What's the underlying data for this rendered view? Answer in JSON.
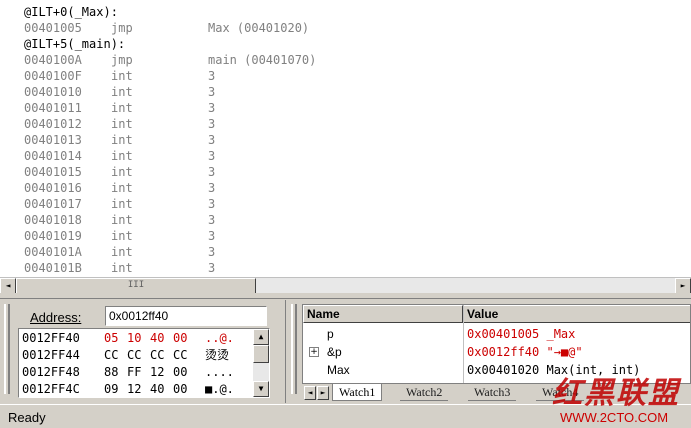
{
  "disassembly": {
    "lines": [
      {
        "kind": "label",
        "addr": "@ILT+0(_Max):",
        "op": "",
        "arg": ""
      },
      {
        "kind": "code",
        "addr": "00401005",
        "op": "jmp",
        "arg": "Max (00401020)"
      },
      {
        "kind": "label",
        "addr": "@ILT+5(_main):",
        "op": "",
        "arg": ""
      },
      {
        "kind": "code",
        "addr": "0040100A",
        "op": "jmp",
        "arg": "main (00401070)"
      },
      {
        "kind": "code",
        "addr": "0040100F",
        "op": "int",
        "arg": "3"
      },
      {
        "kind": "code",
        "addr": "00401010",
        "op": "int",
        "arg": "3"
      },
      {
        "kind": "code",
        "addr": "00401011",
        "op": "int",
        "arg": "3"
      },
      {
        "kind": "code",
        "addr": "00401012",
        "op": "int",
        "arg": "3"
      },
      {
        "kind": "code",
        "addr": "00401013",
        "op": "int",
        "arg": "3"
      },
      {
        "kind": "code",
        "addr": "00401014",
        "op": "int",
        "arg": "3"
      },
      {
        "kind": "code",
        "addr": "00401015",
        "op": "int",
        "arg": "3"
      },
      {
        "kind": "code",
        "addr": "00401016",
        "op": "int",
        "arg": "3"
      },
      {
        "kind": "code",
        "addr": "00401017",
        "op": "int",
        "arg": "3"
      },
      {
        "kind": "code",
        "addr": "00401018",
        "op": "int",
        "arg": "3"
      },
      {
        "kind": "code",
        "addr": "00401019",
        "op": "int",
        "arg": "3"
      },
      {
        "kind": "code",
        "addr": "0040101A",
        "op": "int",
        "arg": "3"
      },
      {
        "kind": "code",
        "addr": "0040101B",
        "op": "int",
        "arg": "3"
      }
    ],
    "hscroll_thumb_glyph": "III",
    "left_arrow": "◄",
    "right_arrow": "►"
  },
  "memory": {
    "address_label": "Address:",
    "address_value": "0x0012ff40",
    "rows": [
      {
        "addr": "0012FF40",
        "bytes": [
          "05",
          "10",
          "40",
          "00"
        ],
        "ascii": "..@.",
        "highlight": true
      },
      {
        "addr": "0012FF44",
        "bytes": [
          "CC",
          "CC",
          "CC",
          "CC"
        ],
        "ascii": "烫烫",
        "highlight": false
      },
      {
        "addr": "0012FF48",
        "bytes": [
          "88",
          "FF",
          "12",
          "00"
        ],
        "ascii": "....",
        "highlight": false
      },
      {
        "addr": "0012FF4C",
        "bytes": [
          "09",
          "12",
          "40",
          "00"
        ],
        "ascii": "■.@.",
        "highlight": false
      }
    ],
    "up_arrow": "▲",
    "down_arrow": "▼"
  },
  "watch": {
    "headers": {
      "name": "Name",
      "value": "Value"
    },
    "rows": [
      {
        "name": "p",
        "value": "0x00401005 _Max",
        "expandable": false,
        "changed": true
      },
      {
        "name": "&p",
        "value": "0x0012ff40 \"→■@\"",
        "expandable": true,
        "changed": true
      },
      {
        "name": "Max",
        "value": "0x00401020 Max(int, int)",
        "expandable": false,
        "changed": false
      }
    ],
    "expand_glyph": "+",
    "tabs": [
      "Watch1",
      "Watch2",
      "Watch3",
      "Watch4"
    ],
    "active_tab": "Watch1"
  },
  "status": {
    "text": "Ready"
  },
  "watermark": {
    "text": "红黑联盟",
    "url": "WWW.2CTO.COM"
  },
  "colors": {
    "changed_value": "#cc0000",
    "disasm_text": "#808080"
  }
}
